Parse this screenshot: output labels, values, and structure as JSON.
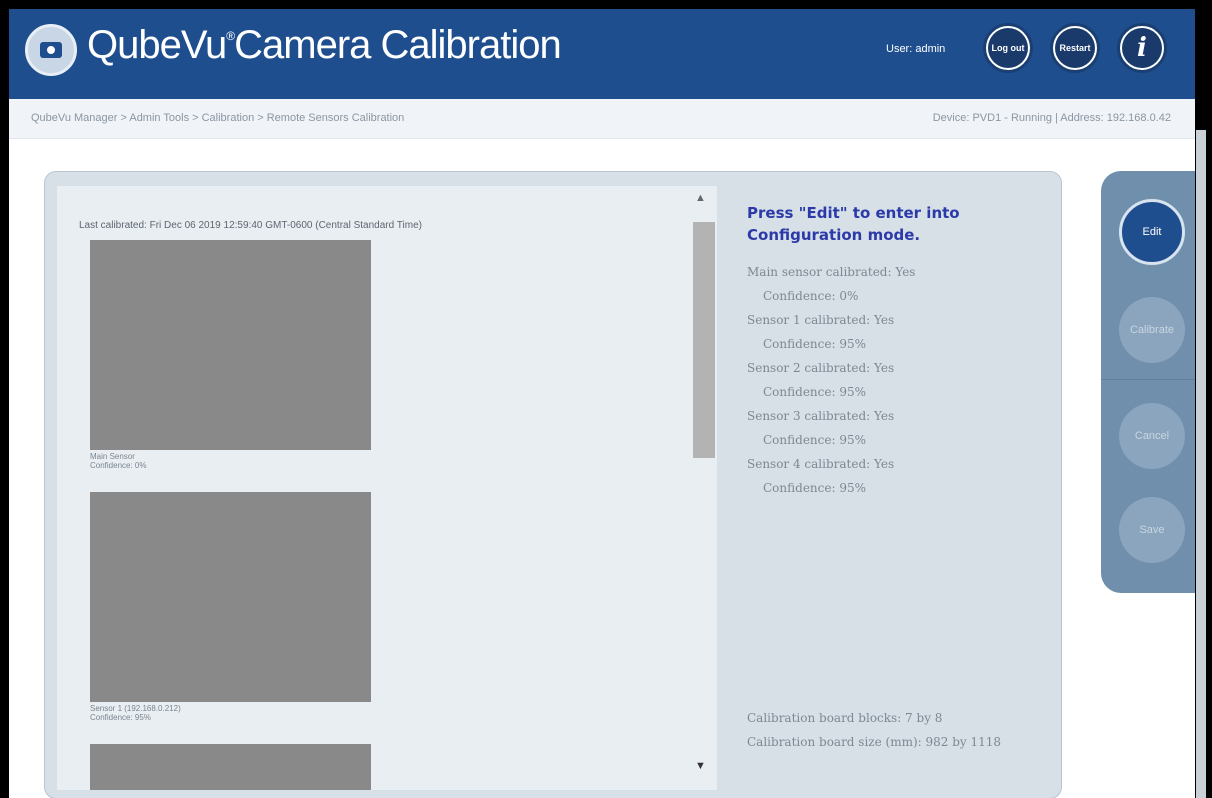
{
  "header": {
    "app_title": "QubeVu",
    "app_title_mark": "®",
    "app_title_rest": "Camera Calibration",
    "user_label": "User: admin",
    "buttons": {
      "logout": "Log out",
      "restart": "Restart",
      "info": "i"
    },
    "brand_color": "#1f4e8f"
  },
  "breadcrumb": {
    "path": "QubeVu Manager > Admin Tools > Calibration > Remote Sensors Calibration",
    "device": "Device: PVD1 - Running | Address: 192.168.0.42"
  },
  "left_pane": {
    "last_calibrated": "Last calibrated: Fri Dec 06 2019 12:59:40 GMT-0600 (Central Standard Time)",
    "thumbnails": [
      {
        "caption_line1": "Main Sensor",
        "caption_line2": "Confidence: 0%"
      },
      {
        "caption_line1": "Sensor 1 (192.168.0.212)",
        "caption_line2": "Confidence: 95%"
      },
      {
        "caption_line1": "",
        "caption_line2": ""
      }
    ]
  },
  "right_pane": {
    "instruction": "Press \"Edit\" to enter into Configuration mode.",
    "status": [
      {
        "label": "Main sensor calibrated: Yes",
        "confidence": "Confidence: 0%"
      },
      {
        "label": "Sensor 1 calibrated: Yes",
        "confidence": "Confidence: 95%"
      },
      {
        "label": "Sensor 2 calibrated: Yes",
        "confidence": "Confidence: 95%"
      },
      {
        "label": "Sensor 3 calibrated: Yes",
        "confidence": "Confidence: 95%"
      },
      {
        "label": "Sensor 4 calibrated: Yes",
        "confidence": "Confidence: 95%"
      }
    ],
    "board_blocks": "Calibration board blocks: 7 by 8",
    "board_size": "Calibration board size (mm): 982 by 1118"
  },
  "side_actions": {
    "edit": "Edit",
    "calibrate": "Calibrate",
    "cancel": "Cancel",
    "save": "Save"
  }
}
